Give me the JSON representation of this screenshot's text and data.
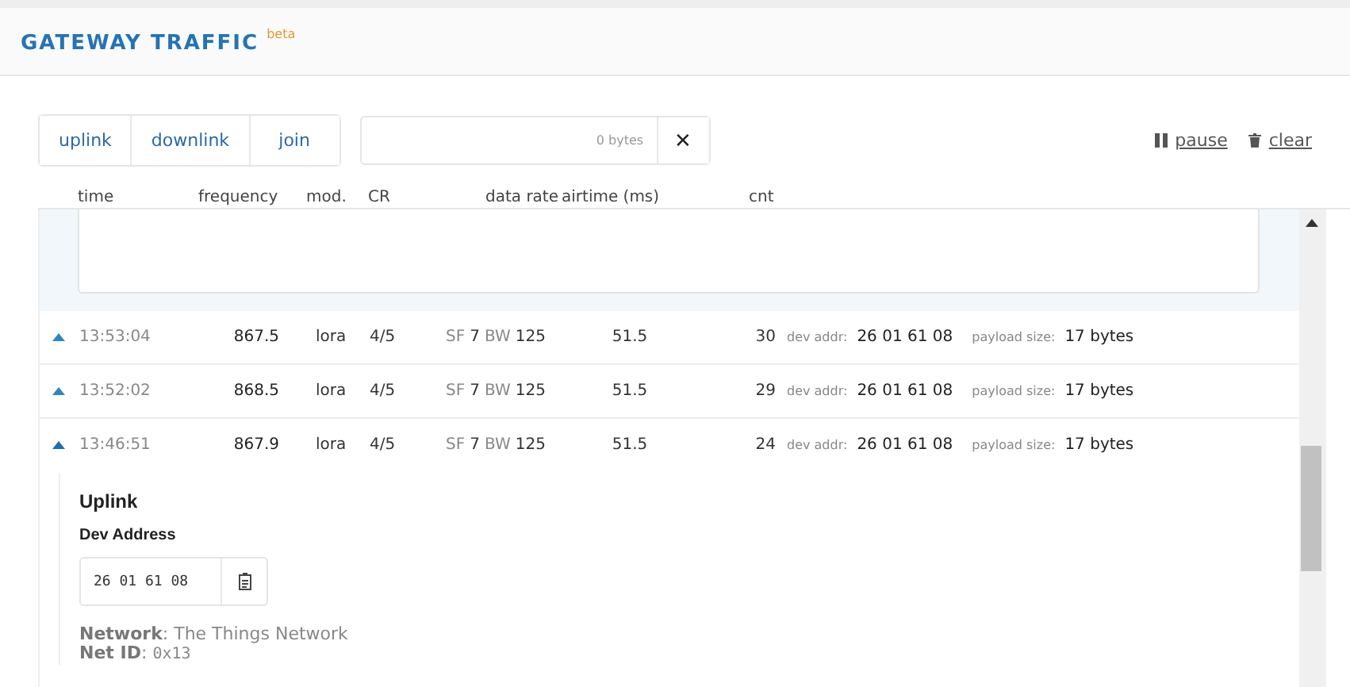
{
  "header": {
    "title": "GATEWAY TRAFFIC",
    "badge": "beta"
  },
  "filters": [
    {
      "label": "uplink",
      "selected": false
    },
    {
      "label": "downlink",
      "selected": false
    },
    {
      "label": "join",
      "selected": false
    }
  ],
  "filter_field": {
    "size": "0 bytes",
    "clear": "✕"
  },
  "actions": [
    {
      "kind": "pause",
      "label": "pause"
    },
    {
      "kind": "clear",
      "label": "clear"
    }
  ],
  "table": {
    "columns": [
      "time",
      "frequency",
      "mod.",
      "CR",
      "data rate",
      "airtime (ms)",
      "cnt"
    ],
    "rows": [
      {
        "expanded": false,
        "time": "13:53:04",
        "frequency": "867.5",
        "mod": "lora",
        "cr": "4/5",
        "sf_label": "SF",
        "sf": "7",
        "bw_label": "BW",
        "bw": "125",
        "airtime": "51.5",
        "cnt": "30",
        "addr_label": "dev addr:",
        "addr": "26 01 61 08",
        "size_label": "payload size:",
        "size": "17 bytes"
      },
      {
        "expanded": false,
        "time": "13:52:02",
        "frequency": "868.5",
        "mod": "lora",
        "cr": "4/5",
        "sf_label": "SF",
        "sf": "7",
        "bw_label": "BW",
        "bw": "125",
        "airtime": "51.5",
        "cnt": "29",
        "addr_label": "dev addr:",
        "addr": "26 01 61 08",
        "size_label": "payload size:",
        "size": "17 bytes"
      },
      {
        "expanded": true,
        "time": "13:46:51",
        "frequency": "867.9",
        "mod": "lora",
        "cr": "4/5",
        "sf_label": "SF",
        "sf": "7",
        "bw_label": "BW",
        "bw": "125",
        "airtime": "51.5",
        "cnt": "24",
        "addr_label": "dev addr:",
        "addr": "26 01 61 08",
        "size_label": "payload size:",
        "size": "17 bytes"
      }
    ]
  },
  "detail": {
    "title": "Uplink",
    "field_label": "Dev Address",
    "field_value": "26 01 61 08",
    "info": [
      {
        "label": "Network",
        "sep": ":",
        "value": "The Things Network",
        "mono": false
      },
      {
        "label": "Net ID",
        "sep": ":",
        "value": "0x13",
        "mono": true
      }
    ]
  }
}
